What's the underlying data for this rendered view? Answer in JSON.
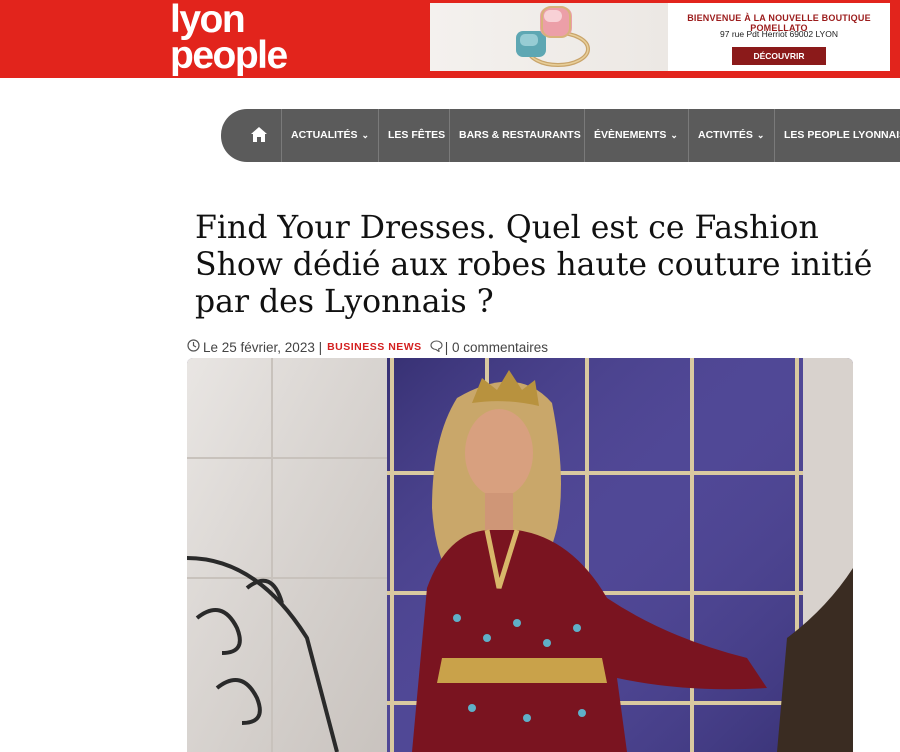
{
  "header": {
    "logo_line1": "lyon",
    "logo_line2": "people",
    "brand_color": "#e2241c",
    "ad": {
      "title": "BIENVENUE À LA NOUVELLE BOUTIQUE POMELLATO",
      "address": "97 rue Pdt Herriot 69002 LYON",
      "button": "DÉCOUVRIR"
    }
  },
  "nav": {
    "home_icon": "home-icon",
    "items": [
      {
        "label": "ACTUALITÉS",
        "dropdown": true
      },
      {
        "label": "LES FÊTES",
        "dropdown": false
      },
      {
        "label": "BARS & RESTAURANTS",
        "dropdown": false
      },
      {
        "label": "ÉVÈNEMENTS",
        "dropdown": true
      },
      {
        "label": "ACTIVITÉS",
        "dropdown": true
      },
      {
        "label": "LES PEOPLE LYONNAIS",
        "dropdown": false
      }
    ],
    "background": "#5b5b5b"
  },
  "article": {
    "title": "Find Your Dresses. Quel est ce Fashion Show dédié aux robes haute couture initié par des Lyonnais ?",
    "date": "Le 25 février, 2023 |",
    "category": "BUSINESS NEWS",
    "comments": "| 0 commentaires",
    "category_color": "#d42020"
  }
}
